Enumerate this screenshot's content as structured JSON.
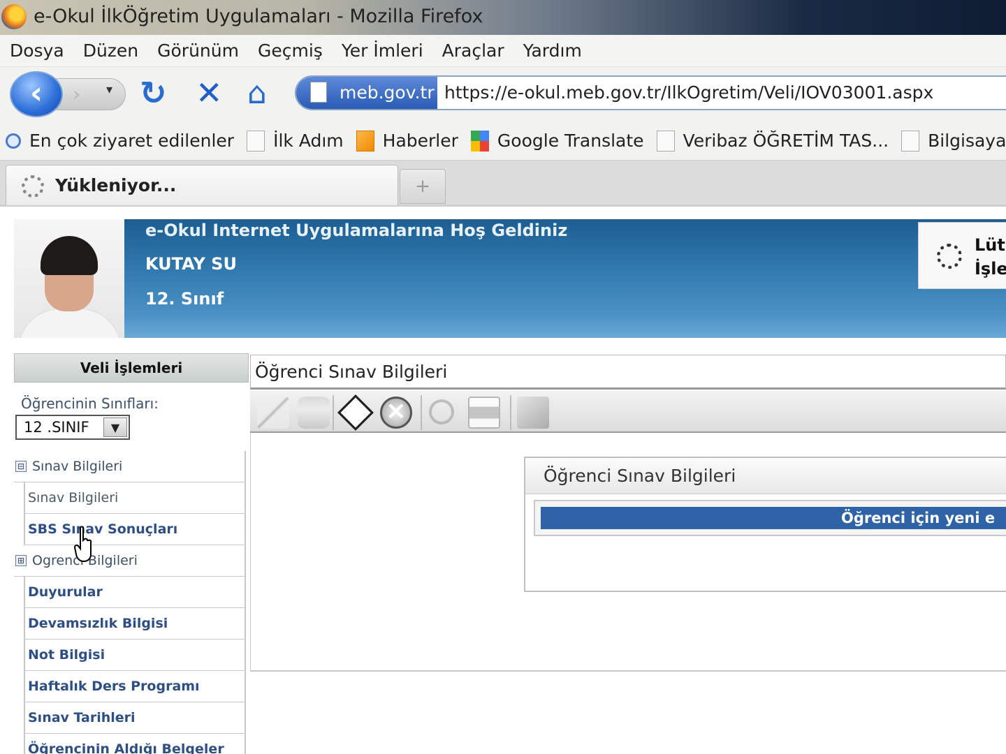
{
  "window": {
    "title": "e-Okul İlkÖğretim Uygulamaları - Mozilla Firefox"
  },
  "menu": [
    "Dosya",
    "Düzen",
    "Görünüm",
    "Geçmiş",
    "Yer İmleri",
    "Araçlar",
    "Yardım"
  ],
  "navigation": {
    "site_identity": "meb.gov.tr",
    "url": "https://e-okul.meb.gov.tr/IlkOgretim/Veli/IOV03001.aspx"
  },
  "bookmarks": [
    "En çok ziyaret edilenler",
    "İlk Adım",
    "Haberler",
    "Google Translate",
    "Veribaz ÖĞRETİM TAS...",
    "Bilgisayar"
  ],
  "tabs": {
    "active_label": "Yükleniyor...",
    "new_tab": "+"
  },
  "header": {
    "welcome": "e-Okul Internet Uygulamalarına Hoş Geldiniz",
    "student_name": "KUTAY SU",
    "grade": "12. Sınıf",
    "loading_line1": "Lüt",
    "loading_line2": "İşle"
  },
  "sidebar": {
    "heading": "Veli İşlemleri",
    "class_label": "Öğrencinin Sınıfları:",
    "class_value": "12 .SINIF",
    "items": [
      {
        "label": "Sınav Bilgileri",
        "type": "group",
        "toggle": "⊟"
      },
      {
        "label": "Sınav Bilgileri",
        "type": "plain"
      },
      {
        "label": "SBS Sınav Sonuçları",
        "type": "link"
      },
      {
        "label": "Ogrenci Bilgileri",
        "type": "group",
        "toggle": "⊞"
      },
      {
        "label": "Duyurular",
        "type": "link"
      },
      {
        "label": "Devamsızlık Bilgisi",
        "type": "link"
      },
      {
        "label": "Not Bilgisi",
        "type": "link"
      },
      {
        "label": "Haftalık Ders Programı",
        "type": "link"
      },
      {
        "label": "Sınav Tarihleri",
        "type": "link"
      },
      {
        "label": "Öğrencinin Aldığı Belgeler",
        "type": "link"
      }
    ]
  },
  "main": {
    "title": "Öğrenci Sınav Bilgileri",
    "toolbar_icons": [
      "edit-icon",
      "database-icon",
      "save-icon",
      "cancel-icon",
      "search-icon",
      "print-icon",
      "export-icon"
    ],
    "panel_title": "Öğrenci Sınav Bilgileri",
    "panel_message": "Öğrenci için yeni e"
  },
  "colors": {
    "banner": "#2f77ad",
    "message_bar": "#2f63a8",
    "link": "#2d4f86"
  }
}
